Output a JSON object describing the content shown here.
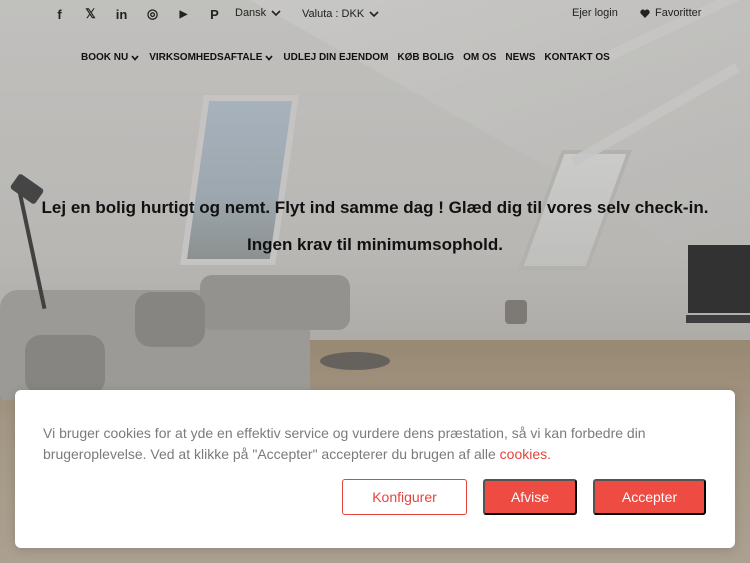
{
  "topbar": {
    "social": [
      {
        "name": "facebook-icon",
        "glyph": "f"
      },
      {
        "name": "x-icon",
        "glyph": "𝕏"
      },
      {
        "name": "linkedin-icon",
        "glyph": "in"
      },
      {
        "name": "instagram-icon",
        "glyph": "◎"
      },
      {
        "name": "youtube-icon",
        "glyph": "▶"
      },
      {
        "name": "pinterest-icon",
        "glyph": "P"
      }
    ],
    "language": "Dansk",
    "currency": "Valuta : DKK",
    "login": "Ejer login",
    "favorites": "Favoritter"
  },
  "nav": {
    "items": [
      {
        "label": "BOOK NU",
        "dropdown": true
      },
      {
        "label": "VIRKSOMHEDSAFTALE",
        "dropdown": true
      },
      {
        "label": "UDLEJ DIN EJENDOM",
        "dropdown": false
      },
      {
        "label": "KØB BOLIG",
        "dropdown": false
      },
      {
        "label": "OM OS",
        "dropdown": false
      },
      {
        "label": "NEWS",
        "dropdown": false
      },
      {
        "label": "KONTAKT OS",
        "dropdown": false
      }
    ]
  },
  "hero": {
    "headline": "Lej en bolig hurtigt og nemt. Flyt ind samme dag ! Glæd dig til vores selv check-in.",
    "subline": "Ingen krav til minimumsophold."
  },
  "cookie": {
    "text": "Vi bruger cookies for at yde en effektiv service og vurdere dens præstation, så vi kan forbedre din brugeroplevelse. Ved at klikke på \"Accepter\" accepterer du brugen af alle ",
    "link": "cookies.",
    "configure": "Konfigurer",
    "reject": "Afvise",
    "accept": "Accepter"
  },
  "colors": {
    "accent": "#ee4b42",
    "text_muted": "#7b7b7b"
  }
}
